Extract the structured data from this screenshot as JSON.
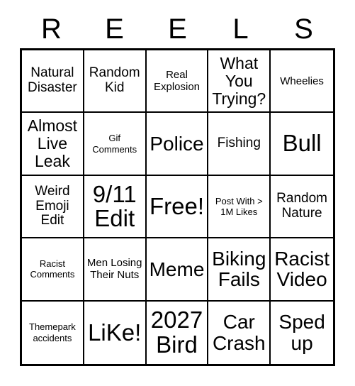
{
  "card": {
    "title_letters": [
      "R",
      "E",
      "E",
      "L",
      "S"
    ],
    "columns": 5,
    "rows": 5,
    "free_space_label": "Free!",
    "free_space_position": "row3-col3",
    "colors": {
      "background": "#ffffff",
      "text": "#000000",
      "grid_line": "#000000"
    },
    "cells": [
      {
        "row": 1,
        "col": 1,
        "text": "Natural Disaster",
        "size": "md"
      },
      {
        "row": 1,
        "col": 2,
        "text": "Random Kid",
        "size": "md"
      },
      {
        "row": 1,
        "col": 3,
        "text": "Real Explosion",
        "size": "sm"
      },
      {
        "row": 1,
        "col": 4,
        "text": "What You Trying?",
        "size": "lg"
      },
      {
        "row": 1,
        "col": 5,
        "text": "Wheelies",
        "size": "sm"
      },
      {
        "row": 2,
        "col": 1,
        "text": "Almost Live Leak",
        "size": "lg"
      },
      {
        "row": 2,
        "col": 2,
        "text": "Gif Comments",
        "size": "xs"
      },
      {
        "row": 2,
        "col": 3,
        "text": "Police",
        "size": "xl"
      },
      {
        "row": 2,
        "col": 4,
        "text": "Fishing",
        "size": "md"
      },
      {
        "row": 2,
        "col": 5,
        "text": "Bull",
        "size": "xxl"
      },
      {
        "row": 3,
        "col": 1,
        "text": "Weird Emoji Edit",
        "size": "md"
      },
      {
        "row": 3,
        "col": 2,
        "text": "9/11 Edit",
        "size": "xxl"
      },
      {
        "row": 3,
        "col": 3,
        "text": "Free!",
        "size": "xxl"
      },
      {
        "row": 3,
        "col": 4,
        "text": "Post With > 1M Likes",
        "size": "xs"
      },
      {
        "row": 3,
        "col": 5,
        "text": "Random Nature",
        "size": "md"
      },
      {
        "row": 4,
        "col": 1,
        "text": "Racist Comments",
        "size": "xs"
      },
      {
        "row": 4,
        "col": 2,
        "text": "Men Losing Their Nuts",
        "size": "sm"
      },
      {
        "row": 4,
        "col": 3,
        "text": "Meme",
        "size": "xl"
      },
      {
        "row": 4,
        "col": 4,
        "text": "Biking Fails",
        "size": "xl"
      },
      {
        "row": 4,
        "col": 5,
        "text": "Racist Video",
        "size": "xl"
      },
      {
        "row": 5,
        "col": 1,
        "text": "Themepark accidents",
        "size": "xs"
      },
      {
        "row": 5,
        "col": 2,
        "text": "LiKe!",
        "size": "xxl"
      },
      {
        "row": 5,
        "col": 3,
        "text": "2027 Bird",
        "size": "xxl"
      },
      {
        "row": 5,
        "col": 4,
        "text": "Car Crash",
        "size": "xl"
      },
      {
        "row": 5,
        "col": 5,
        "text": "Sped up",
        "size": "xl"
      }
    ]
  }
}
